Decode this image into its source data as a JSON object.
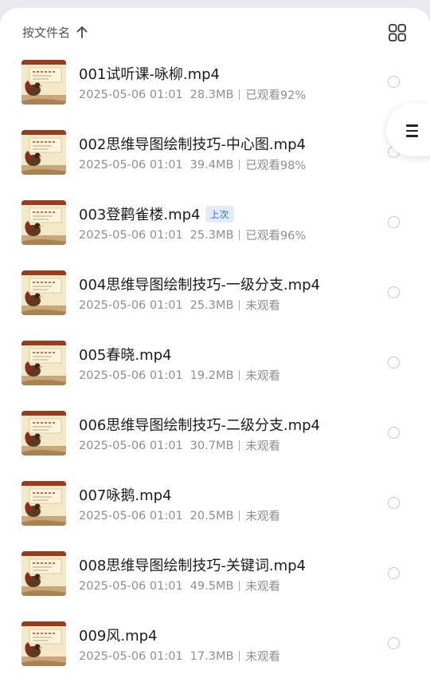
{
  "header": {
    "sort_label": "按文件名"
  },
  "icons": {
    "sort": "arrow-up-icon",
    "view_toggle": "grid-view-icon",
    "side": "menu-icon",
    "select": "radio-circle-icon"
  },
  "files": [
    {
      "name": "001试听课-咏柳.mp4",
      "date": "2025-05-06 01:01",
      "size": "28.3MB",
      "status": "已观看92%",
      "badge": ""
    },
    {
      "name": "002思维导图绘制技巧-中心图.mp4",
      "date": "2025-05-06 01:01",
      "size": "39.4MB",
      "status": "已观看98%",
      "badge": ""
    },
    {
      "name": "003登鹳雀楼.mp4",
      "date": "2025-05-06 01:01",
      "size": "25.3MB",
      "status": "已观看96%",
      "badge": "上次"
    },
    {
      "name": "004思维导图绘制技巧-一级分支.mp4",
      "date": "2025-05-06 01:01",
      "size": "25.3MB",
      "status": "未观看",
      "badge": ""
    },
    {
      "name": "005春晓.mp4",
      "date": "2025-05-06 01:01",
      "size": "19.2MB",
      "status": "未观看",
      "badge": ""
    },
    {
      "name": "006思维导图绘制技巧-二级分支.mp4",
      "date": "2025-05-06 01:01",
      "size": "30.7MB",
      "status": "未观看",
      "badge": ""
    },
    {
      "name": "007咏鹅.mp4",
      "date": "2025-05-06 01:01",
      "size": "20.5MB",
      "status": "未观看",
      "badge": ""
    },
    {
      "name": "008思维导图绘制技巧-关键词.mp4",
      "date": "2025-05-06 01:01",
      "size": "49.5MB",
      "status": "未观看",
      "badge": ""
    },
    {
      "name": "009风.mp4",
      "date": "2025-05-06 01:01",
      "size": "17.3MB",
      "status": "未观看",
      "badge": ""
    }
  ]
}
